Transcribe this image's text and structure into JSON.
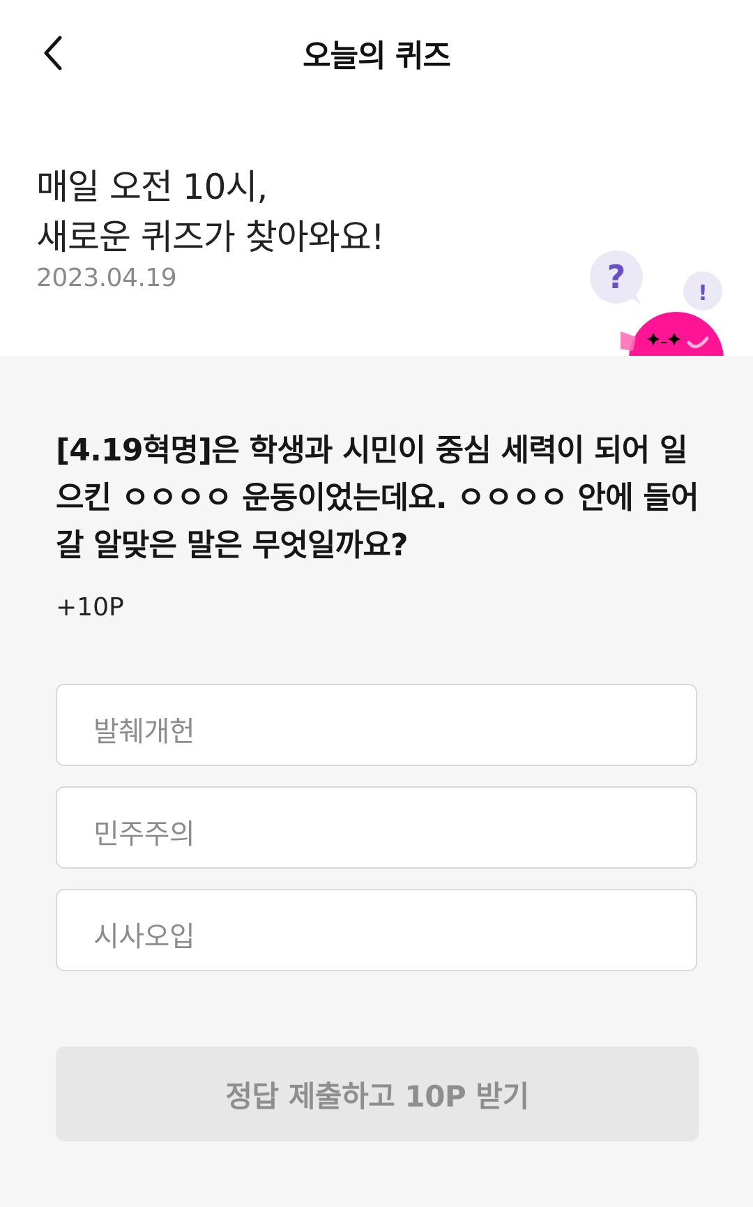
{
  "header": {
    "title": "오늘의 퀴즈",
    "back_icon": "chevron-left-icon"
  },
  "hero": {
    "line1": "매일 오전 10시,",
    "line2": "새로운 퀴즈가 찾아와요!",
    "date": "2023.04.19",
    "mascot_question_mark": "?",
    "mascot_exclaim_mark": "!",
    "mascot_color": "#ff1493",
    "bubble_color": "#ece9f7",
    "mark_color": "#6a4fc6"
  },
  "quiz": {
    "question": "[4.19혁명]은 학생과 시민이 중심 세력이 되어 일으킨 ㅇㅇㅇㅇ 운동이었는데요. ㅇㅇㅇㅇ 안에 들어갈 알맞은 말은 무엇일까요?",
    "points": "+10P",
    "options": [
      {
        "label": "발췌개헌"
      },
      {
        "label": "민주주의"
      },
      {
        "label": "시사오입"
      }
    ],
    "submit_label": "정답 제출하고 10P 받기"
  }
}
